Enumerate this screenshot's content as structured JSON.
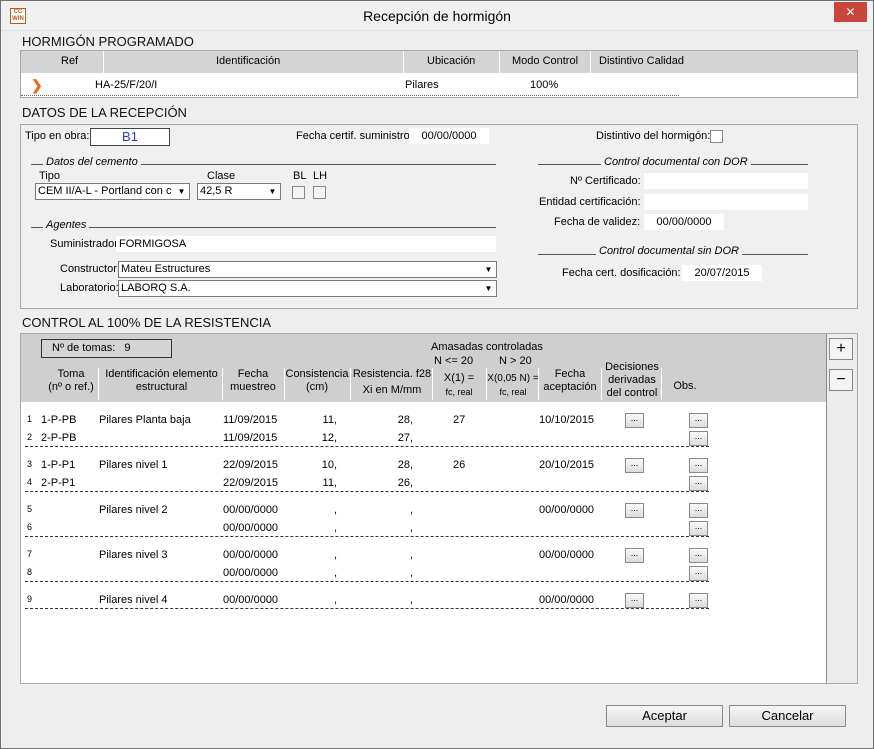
{
  "window": {
    "title": "Recepción de hormigón",
    "close": "✕",
    "app_icon": "CC WIN"
  },
  "programado": {
    "section": "HORMIGÓN PROGRAMADO",
    "headers": [
      "Ref",
      "Identificación",
      "Ubicación",
      "Modo Control",
      "Distintivo Calidad"
    ],
    "row": {
      "marker": "❯",
      "ident": "HA-25/F/20/I",
      "ubicacion": "Pilares",
      "modo": "100%"
    }
  },
  "recepcion": {
    "section": "DATOS DE LA RECEPCIÓN",
    "tipo_obra_label": "Tipo en obra:",
    "tipo_obra": "B1",
    "fecha_cert_label": "Fecha certif. suministro:",
    "fecha_cert": "00/00/0000",
    "distintivo_label": "Distintivo del hormigón:",
    "cemento_group": "Datos del cemento",
    "tipo_label": "Tipo",
    "tipo_value": "CEM II/A-L - Portland con c",
    "clase_label": "Clase",
    "clase_value": "42,5 R",
    "bl_label": "BL",
    "lh_label": "LH",
    "agentes_group": "Agentes",
    "suministrador_label": "Suministrador:",
    "suministrador": "FORMIGOSA",
    "constructor_label": "Constructor:",
    "constructor": "Mateu Estructures",
    "laboratorio_label": "Laboratorio:",
    "laboratorio": "LABORQ S.A.",
    "con_dor_group": "Control documental  con DOR",
    "certificado_label": "Nº Certificado:",
    "entidad_label": "Entidad certificación:",
    "validez_label": "Fecha de validez:",
    "validez": "00/00/0000",
    "sin_dor_group": "Control documental  sin DOR",
    "dosificacion_label": "Fecha cert. dosificación:",
    "dosificacion": "20/07/2015"
  },
  "control": {
    "section": "CONTROL AL 100% DE LA RESISTENCIA",
    "tomas_label": "Nº de tomas:",
    "tomas": "9",
    "amasadas": "Amasadas controladas",
    "n20a": "N <= 20",
    "n20b": "N > 20",
    "h_toma": "Toma\n(nº o ref.)",
    "h_ident": "Identificación elemento\nestructural",
    "h_fecha": "Fecha\nmuestreo",
    "h_consist": "Consistencia\n(cm)",
    "h_resist": "Resistencia. f28",
    "h_resist2": "Xi  en M/mm",
    "h_x1": "X(1) =",
    "h_x1b": "fc, real",
    "h_x2": "X(0,05 N) =",
    "h_x2b": "fc, real",
    "h_acept": "Fecha\naceptación",
    "h_decis": "Decisiones\nderivadas\ndel control",
    "h_obs": "Obs.",
    "plus": "+",
    "minus": "−",
    "dots": "...",
    "rows": [
      {
        "n": "1",
        "ref": "1-P-PB",
        "elem": "Pilares Planta baja",
        "fecha": "11/09/2015",
        "cons": "11,",
        "res": "28,",
        "x1": "27",
        "acept": "10/10/2015"
      },
      {
        "n": "2",
        "ref": "2-P-PB",
        "elem": "",
        "fecha": "11/09/2015",
        "cons": "12,",
        "res": "27,",
        "x1": "",
        "acept": ""
      },
      {
        "n": "3",
        "ref": "1-P-P1",
        "elem": "Pilares nivel 1",
        "fecha": "22/09/2015",
        "cons": "10,",
        "res": "28,",
        "x1": "26",
        "acept": "20/10/2015"
      },
      {
        "n": "4",
        "ref": "2-P-P1",
        "elem": "",
        "fecha": "22/09/2015",
        "cons": "11,",
        "res": "26,",
        "x1": "",
        "acept": ""
      },
      {
        "n": "5",
        "ref": "",
        "elem": "Pilares nivel 2",
        "fecha": "00/00/0000",
        "cons": ",",
        "res": ",",
        "x1": "",
        "acept": "00/00/0000"
      },
      {
        "n": "6",
        "ref": "",
        "elem": "",
        "fecha": "00/00/0000",
        "cons": ",",
        "res": ",",
        "x1": "",
        "acept": ""
      },
      {
        "n": "7",
        "ref": "",
        "elem": "Pilares nivel 3",
        "fecha": "00/00/0000",
        "cons": ",",
        "res": ",",
        "x1": "",
        "acept": "00/00/0000"
      },
      {
        "n": "8",
        "ref": "",
        "elem": "",
        "fecha": "00/00/0000",
        "cons": ",",
        "res": ",",
        "x1": "",
        "acept": ""
      },
      {
        "n": "9",
        "ref": "",
        "elem": "Pilares nivel 4",
        "fecha": "00/00/0000",
        "cons": ",",
        "res": ",",
        "x1": "",
        "acept": "00/00/0000"
      }
    ]
  },
  "buttons": {
    "accept": "Aceptar",
    "cancel": "Cancelar"
  }
}
